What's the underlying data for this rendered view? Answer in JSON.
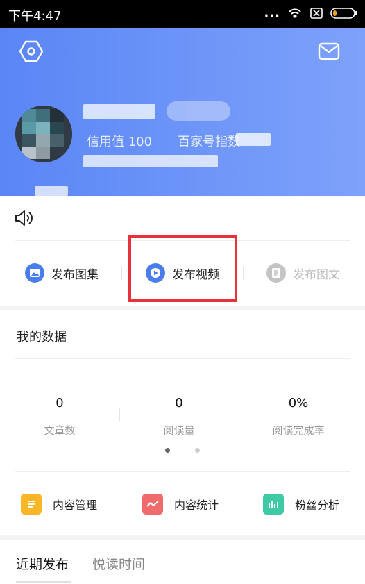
{
  "status_bar": {
    "time": "下午4:47",
    "more": "..."
  },
  "profile": {
    "credit": "信用值 100",
    "baijia_index": "百家号指数"
  },
  "actions": [
    {
      "label": "发布图集",
      "color": "#4a7ef0"
    },
    {
      "label": "发布视频",
      "color": "#4a7ef0"
    },
    {
      "label": "发布图文",
      "color": "#bdbdbd"
    }
  ],
  "my_data": {
    "title": "我的数据",
    "metrics": [
      {
        "value": "0",
        "label": "文章数"
      },
      {
        "value": "0",
        "label": "阅读量"
      },
      {
        "value": "0%",
        "label": "阅读完成率"
      }
    ]
  },
  "tools": [
    {
      "label": "内容管理",
      "color": "#f9b626",
      "icon": "document-icon"
    },
    {
      "label": "内容统计",
      "color": "#f06b6b",
      "icon": "trend-icon"
    },
    {
      "label": "粉丝分析",
      "color": "#3ecaa5",
      "icon": "bar-chart-icon"
    }
  ],
  "tabs": [
    {
      "label": "近期发布"
    },
    {
      "label": "悦读时间"
    }
  ],
  "colors": {
    "brand_blue": "#5a86f5",
    "highlight_red": "#e8323a"
  }
}
